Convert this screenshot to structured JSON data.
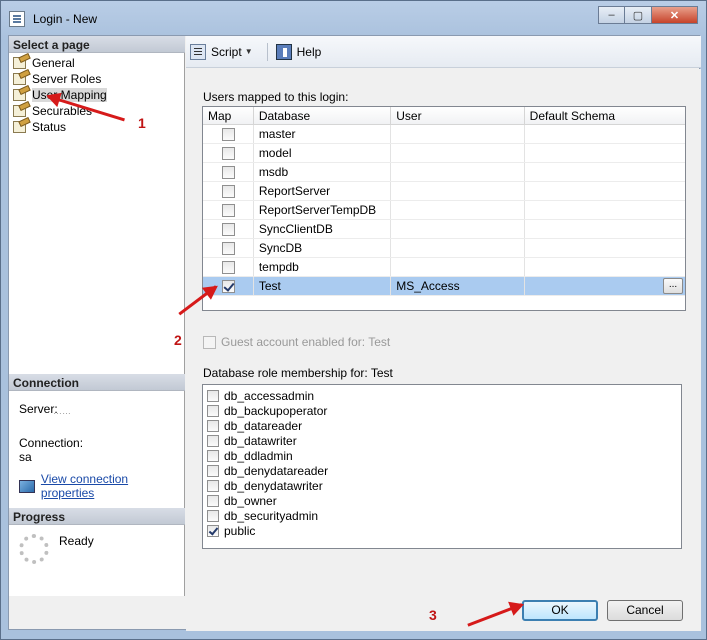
{
  "window": {
    "title": "Login - New",
    "controls": {
      "minimize": "–",
      "maximize": "▢",
      "close": "✕"
    }
  },
  "left": {
    "pages_header": "Select a page",
    "pages": [
      "General",
      "Server Roles",
      "User Mapping",
      "Securables",
      "Status"
    ],
    "selected_page": "User Mapping",
    "connection_header": "Connection",
    "server_label": "Server:",
    "server_value": "……",
    "connection_label": "Connection:",
    "connection_value": "sa",
    "view_connection": "View connection properties",
    "progress_header": "Progress",
    "progress_status": "Ready"
  },
  "toolbar": {
    "script": "Script",
    "help": "Help"
  },
  "users_mapped": {
    "label": "Users mapped to this login:",
    "columns": [
      "Map",
      "Database",
      "User",
      "Default Schema"
    ],
    "rows": [
      {
        "map": false,
        "database": "master",
        "user": "",
        "schema": ""
      },
      {
        "map": false,
        "database": "model",
        "user": "",
        "schema": ""
      },
      {
        "map": false,
        "database": "msdb",
        "user": "",
        "schema": ""
      },
      {
        "map": false,
        "database": "ReportServer",
        "user": "",
        "schema": ""
      },
      {
        "map": false,
        "database": "ReportServerTempDB",
        "user": "",
        "schema": ""
      },
      {
        "map": false,
        "database": "SyncClientDB",
        "user": "",
        "schema": ""
      },
      {
        "map": false,
        "database": "SyncDB",
        "user": "",
        "schema": ""
      },
      {
        "map": false,
        "database": "tempdb",
        "user": "",
        "schema": ""
      },
      {
        "map": true,
        "database": "Test",
        "user": "MS_Access",
        "schema": "",
        "selected": true
      }
    ],
    "ellipsis": "..."
  },
  "guest_account": "Guest account enabled for: Test",
  "role_membership": {
    "label": "Database role membership for: Test",
    "roles": [
      {
        "name": "db_accessadmin",
        "checked": false
      },
      {
        "name": "db_backupoperator",
        "checked": false
      },
      {
        "name": "db_datareader",
        "checked": false
      },
      {
        "name": "db_datawriter",
        "checked": false
      },
      {
        "name": "db_ddladmin",
        "checked": false
      },
      {
        "name": "db_denydatareader",
        "checked": false
      },
      {
        "name": "db_denydatawriter",
        "checked": false
      },
      {
        "name": "db_owner",
        "checked": false
      },
      {
        "name": "db_securityadmin",
        "checked": false
      },
      {
        "name": "public",
        "checked": true
      }
    ]
  },
  "buttons": {
    "ok": "OK",
    "cancel": "Cancel"
  },
  "annotations": [
    "1",
    "2",
    "3"
  ],
  "colors": {
    "annotation_red": "#d61a1a",
    "selection": "#aacbf0",
    "ok_border": "#3c7fb1"
  }
}
